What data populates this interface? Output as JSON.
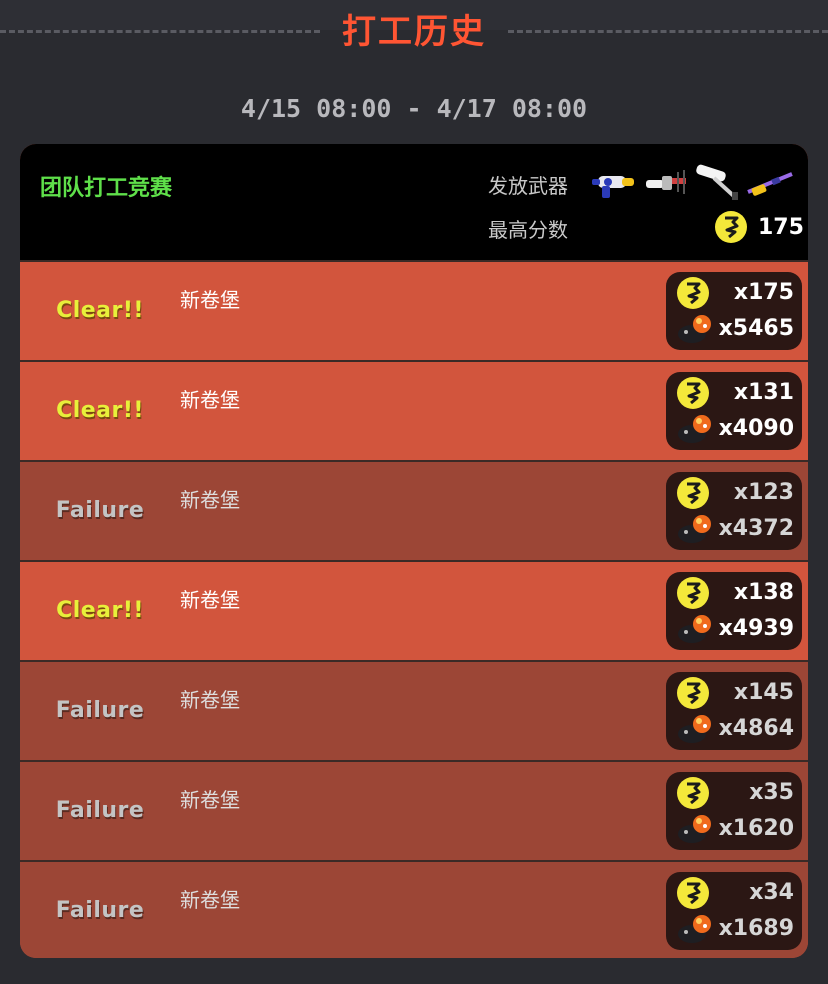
{
  "header": {
    "title": "打工历史"
  },
  "date_range": "4/15 08:00 - 4/17 08:00",
  "event": {
    "name": "团队打工竞赛",
    "weapons_label": "发放武器",
    "max_score_label": "最高分数",
    "max_score": "175",
    "weapons": [
      "blaster-icon",
      "splatling-icon",
      "roller-icon",
      "charger-icon"
    ]
  },
  "rows": [
    {
      "result": "Clear!!",
      "stage": "新卷堡",
      "eggs": "x175",
      "roe": "x5465"
    },
    {
      "result": "Clear!!",
      "stage": "新卷堡",
      "eggs": "x131",
      "roe": "x4090"
    },
    {
      "result": "Failure",
      "stage": "新卷堡",
      "eggs": "x123",
      "roe": "x4372"
    },
    {
      "result": "Clear!!",
      "stage": "新卷堡",
      "eggs": "x138",
      "roe": "x4939"
    },
    {
      "result": "Failure",
      "stage": "新卷堡",
      "eggs": "x145",
      "roe": "x4864"
    },
    {
      "result": "Failure",
      "stage": "新卷堡",
      "eggs": "x35",
      "roe": "x1620"
    },
    {
      "result": "Failure",
      "stage": "新卷堡",
      "eggs": "x34",
      "roe": "x1689"
    }
  ],
  "colors": {
    "title": "#ff5533",
    "event_name": "#5fe04a",
    "clear_row": "#d2553d",
    "failure_row": "#9c4636",
    "clear_text": "#e8f03a",
    "golden_egg": "#f4e83a"
  }
}
